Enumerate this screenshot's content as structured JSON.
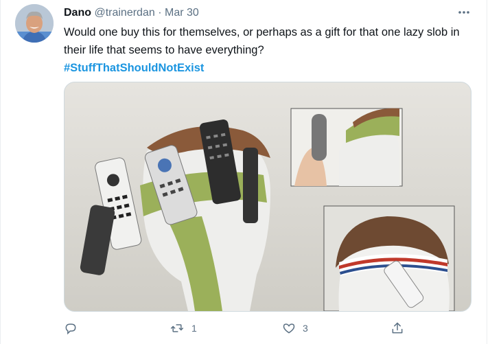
{
  "tweet": {
    "author_name": "Dano",
    "author_handle": "@trainerdan",
    "separator": "·",
    "date": "Mar 30",
    "text": "Would one buy this for themselves, or perhaps as a gift for that one lazy slob in their life that seems to have everything?",
    "hashtag": "#StuffThatShouldNotExist",
    "more_icon": "more-horizontal-icon"
  },
  "actions": {
    "reply": {
      "icon": "reply-icon",
      "count": ""
    },
    "retweet": {
      "icon": "retweet-icon",
      "count": "1"
    },
    "like": {
      "icon": "heart-icon",
      "count": "3"
    },
    "share": {
      "icon": "share-icon",
      "count": ""
    }
  },
  "colors": {
    "text": "#0f1419",
    "secondary": "#5b7083",
    "hashtag": "#1b95e0",
    "border": "#cfd9de"
  }
}
